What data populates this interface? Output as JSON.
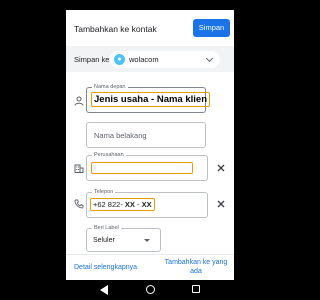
{
  "header": {
    "title": "Tambahkan ke kontak",
    "save_label": "Simpan"
  },
  "account": {
    "label": "Simpan ke",
    "name": "wolacom",
    "icon": "chat-bubble-icon"
  },
  "fields": {
    "first_name": {
      "label": "Nama depan",
      "value": "Jenis usaha - Nama klien",
      "icon": "person-icon"
    },
    "last_name": {
      "placeholder": "Nama belakang"
    },
    "company": {
      "label": "Perusahaan",
      "value": "",
      "icon": "building-icon"
    },
    "phone": {
      "label": "Telepon",
      "prefix": "+62 822-",
      "part1": "XX",
      "sep": "-",
      "part2": "XX",
      "icon": "phone-icon"
    }
  },
  "phone_type": {
    "label": "Beri Label",
    "value": "Seluler"
  },
  "footer": {
    "more_details": "Detail selengkapnya",
    "add_existing": "Tambahkan ke yang ada"
  },
  "colors": {
    "accent": "#1a73e8",
    "highlight": "#f29900",
    "account_row_bg": "#f1f3f4"
  }
}
